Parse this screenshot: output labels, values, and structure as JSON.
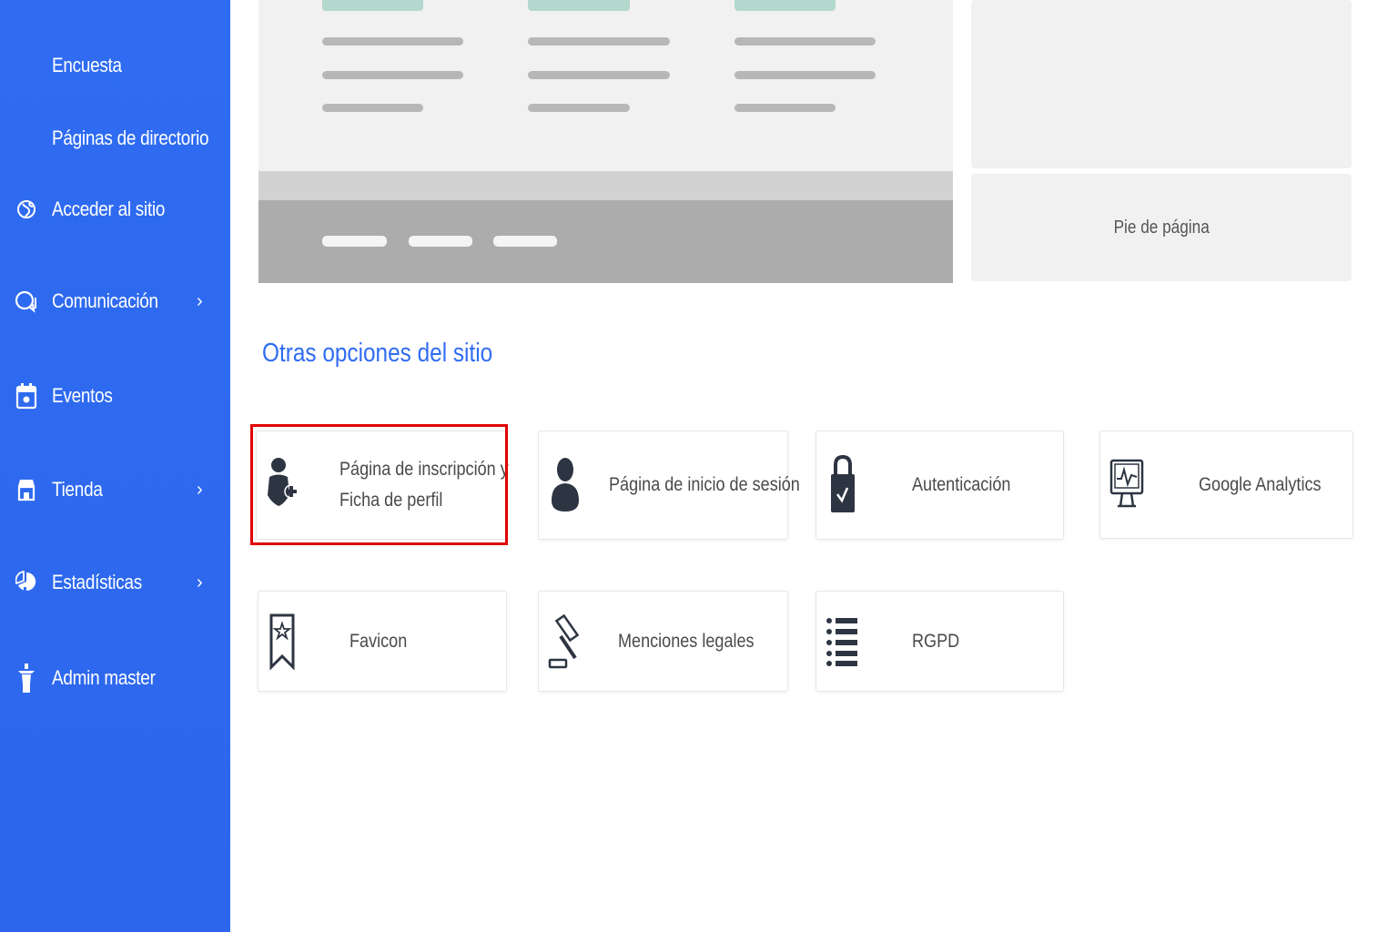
{
  "sidebar": {
    "items": [
      {
        "label": "Encuesta",
        "icon": "none",
        "has_submenu": false
      },
      {
        "label": "Páginas de directorio",
        "icon": "none",
        "has_submenu": false
      },
      {
        "label": "Acceder al sitio",
        "icon": "globe-icon",
        "has_submenu": false
      },
      {
        "label": "Comunicación",
        "icon": "chat-icon",
        "has_submenu": true
      },
      {
        "label": "Eventos",
        "icon": "calendar-icon",
        "has_submenu": false
      },
      {
        "label": "Tienda",
        "icon": "shop-icon",
        "has_submenu": true
      },
      {
        "label": "Estadísticas",
        "icon": "pie-chart-icon",
        "has_submenu": true
      },
      {
        "label": "Admin master",
        "icon": "admin-icon",
        "has_submenu": false
      }
    ],
    "chevron": "›",
    "background_color": "#2f6cf2"
  },
  "layout_preview": {
    "footer_label": "Pie de página"
  },
  "section": {
    "title": "Otras opciones del sitio",
    "title_color": "#2f6cf2"
  },
  "options": [
    {
      "label_line1": "Página de inscripción y",
      "label_line2": "Ficha de perfil",
      "icon": "user-add-icon",
      "highlighted": true
    },
    {
      "label": "Página de inicio de sesión",
      "icon": "user-icon"
    },
    {
      "label": "Autenticación",
      "icon": "lock-icon"
    },
    {
      "label": "Google Analytics",
      "icon": "monitor-chart-icon"
    },
    {
      "label": "Favicon",
      "icon": "bookmark-star-icon"
    },
    {
      "label": "Menciones legales",
      "icon": "gavel-icon"
    },
    {
      "label": "RGPD",
      "icon": "list-icon"
    }
  ],
  "highlight_color": "#e00000"
}
